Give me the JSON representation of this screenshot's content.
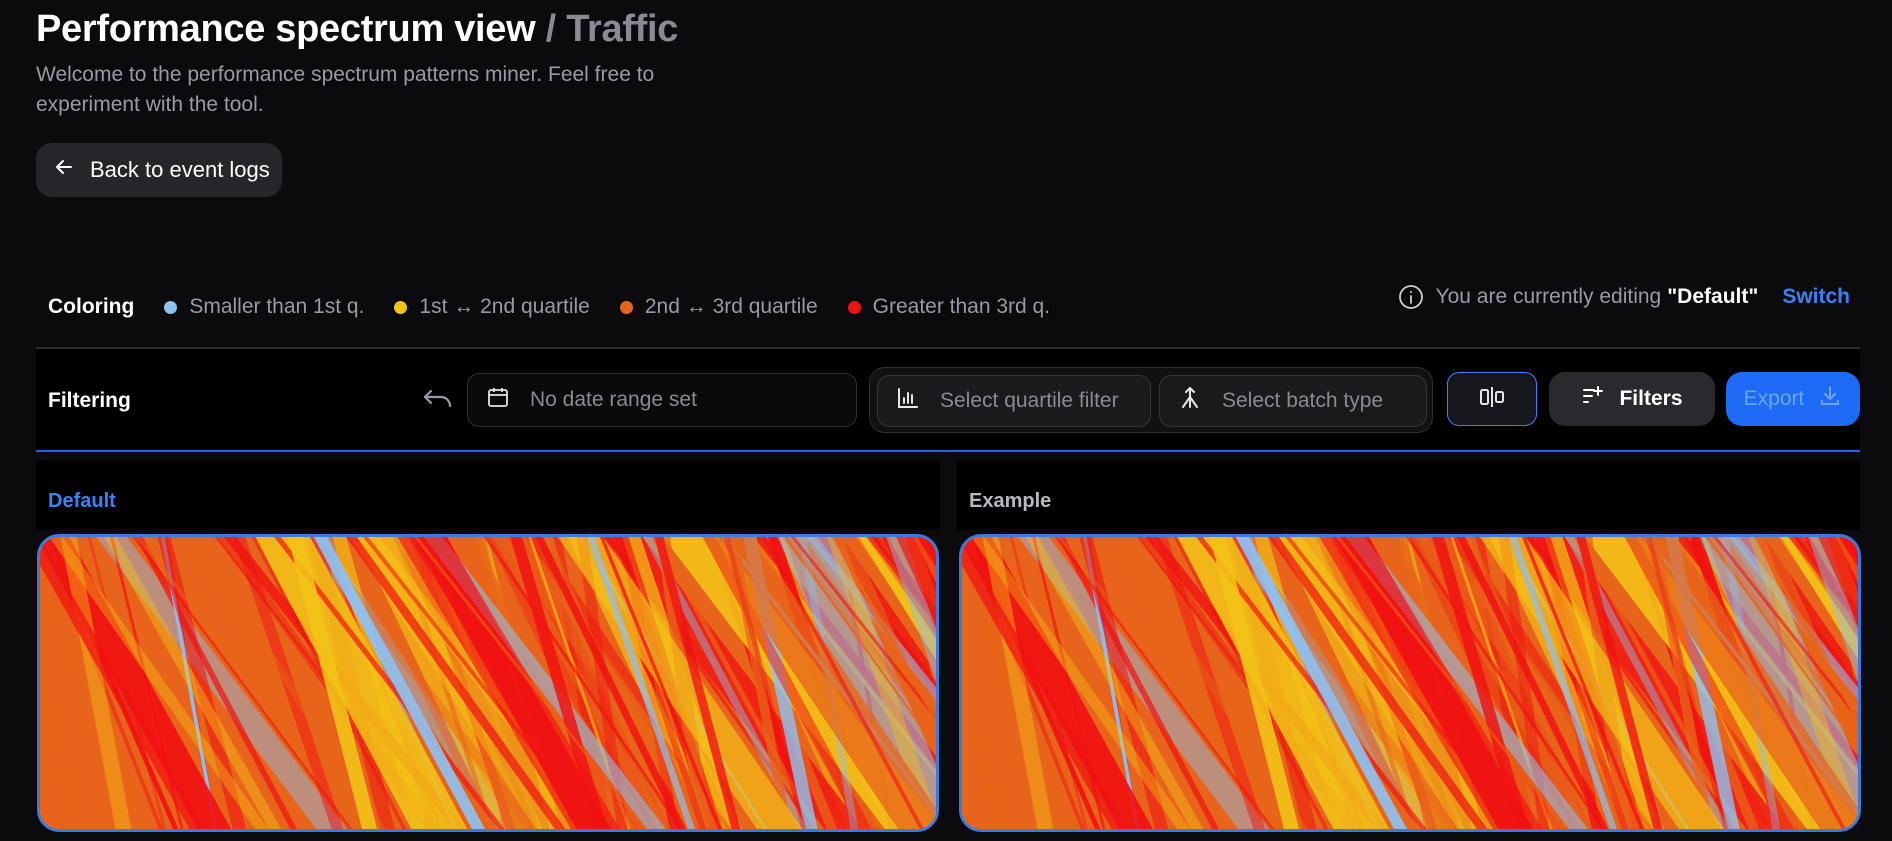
{
  "header": {
    "title": "Performance spectrum view",
    "separator": "/",
    "breadcrumb": "Traffic",
    "subtitle": "Welcome to the performance spectrum patterns miner. Feel free to experiment with the tool.",
    "back_label": "Back to event logs"
  },
  "coloring": {
    "label": "Coloring",
    "legend": [
      {
        "label": "Smaller than 1st q.",
        "color": "#8ec0f0"
      },
      {
        "label": "1st ↔ 2nd quartile",
        "color": "#f2c418"
      },
      {
        "label": "2nd ↔ 3rd quartile",
        "color": "#e8641a"
      },
      {
        "label": "Greater than 3rd q.",
        "color": "#f01212"
      }
    ]
  },
  "editing": {
    "prefix": "You are currently editing",
    "name": "\"Default\"",
    "switch_label": "Switch"
  },
  "filtering": {
    "label": "Filtering",
    "date_placeholder": "No date range set",
    "quartile_placeholder": "Select quartile filter",
    "batch_placeholder": "Select batch type",
    "filters_label": "Filters",
    "export_label": "Export"
  },
  "panels": [
    {
      "title": "Default"
    },
    {
      "title": "Example"
    }
  ],
  "colors": {
    "accent": "#3b82f6",
    "background": "#0b0b0d",
    "red": "#f01212",
    "orange": "#e8641a",
    "yellow": "#f2c418",
    "blue": "#8ec0f0"
  }
}
